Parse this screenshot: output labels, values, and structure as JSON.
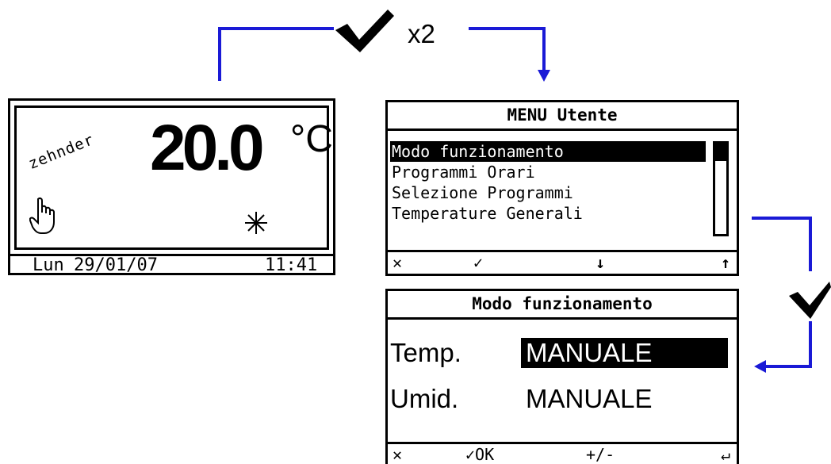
{
  "steps": {
    "step1_label": "x2"
  },
  "screen_home": {
    "brand": "zehnder",
    "temperature": "20.0",
    "unit": "°C",
    "day": "Lun",
    "date": "29/01/07",
    "time": "11:41",
    "icons": [
      "hand-icon",
      "snowflake-icon"
    ]
  },
  "screen_menu": {
    "title": "MENU Utente",
    "items": [
      {
        "label": "Modo funzionamento",
        "selected": true
      },
      {
        "label": "Programmi Orari",
        "selected": false
      },
      {
        "label": "Selezione Programmi",
        "selected": false
      },
      {
        "label": "Temperature Generali",
        "selected": false
      }
    ],
    "softkeys": [
      "✕",
      "✓",
      "↓",
      "↑"
    ]
  },
  "screen_mode": {
    "title": "Modo funzionamento",
    "rows": [
      {
        "label": "Temp.",
        "value": "MANUALE",
        "selected": true
      },
      {
        "label": "Umid.",
        "value": "MANUALE",
        "selected": false
      }
    ],
    "softkeys": [
      "✕",
      "✓OK",
      "+/-",
      "↵"
    ]
  },
  "colors": {
    "connector": "#1a1ad6",
    "ink": "#000000"
  }
}
